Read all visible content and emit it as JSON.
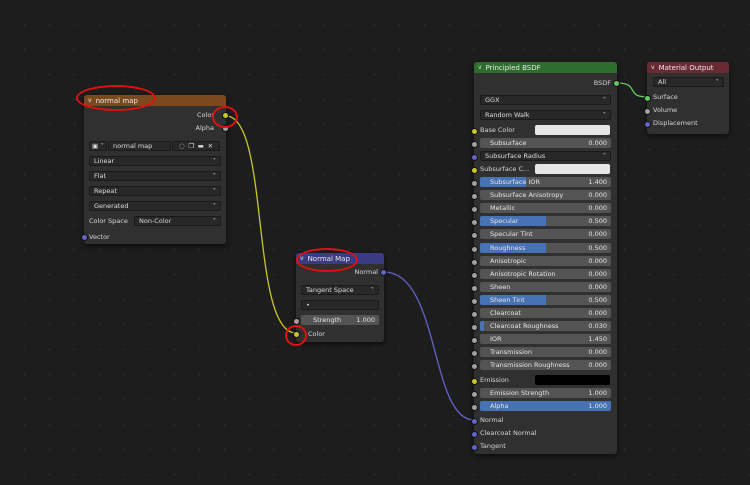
{
  "nodes": {
    "image": {
      "title": "normal map",
      "outputs": [
        "Color",
        "Alpha"
      ],
      "image_name": "normal map",
      "dropdowns": [
        "Linear",
        "Flat",
        "Repeat",
        "Generated"
      ],
      "color_space_label": "Color Space",
      "color_space_value": "Non-Color",
      "input": "Vector",
      "header_color": "#7a4a1e"
    },
    "normal_map": {
      "title": "Normal Map",
      "output": "Normal",
      "space": "Tangent Space",
      "uv_value": "•",
      "strength_label": "Strength",
      "strength_value": "1.000",
      "input": "Color",
      "header_color": "#3b3b84"
    },
    "bsdf": {
      "title": "Principled BSDF",
      "output": "BSDF",
      "distribution": "GGX",
      "subsurface_method": "Random Walk",
      "base_color_label": "Base Color",
      "subsurface": {
        "label": "Subsurface",
        "value": "0.000"
      },
      "subsurface_radius": "Subsurface Radius",
      "subsurface_color_label": "Subsurface C...",
      "fields": [
        {
          "label": "Subsurface IOR",
          "value": "1.400",
          "fill": 0.35
        },
        {
          "label": "Subsurface Anisotropy",
          "value": "0.000",
          "fill": 0
        },
        {
          "label": "Metallic",
          "value": "0.000",
          "fill": 0
        },
        {
          "label": "Specular",
          "value": "0.500",
          "fill": 0.5
        },
        {
          "label": "Specular Tint",
          "value": "0.000",
          "fill": 0
        },
        {
          "label": "Roughness",
          "value": "0.500",
          "fill": 0.5
        },
        {
          "label": "Anisotropic",
          "value": "0.000",
          "fill": 0
        },
        {
          "label": "Anisotropic Rotation",
          "value": "0.000",
          "fill": 0
        },
        {
          "label": "Sheen",
          "value": "0.000",
          "fill": 0
        },
        {
          "label": "Sheen Tint",
          "value": "0.500",
          "fill": 0.5
        },
        {
          "label": "Clearcoat",
          "value": "0.000",
          "fill": 0
        },
        {
          "label": "Clearcoat Roughness",
          "value": "0.030",
          "fill": 0.03
        },
        {
          "label": "IOR",
          "value": "1.450",
          "fill": 0
        },
        {
          "label": "Transmission",
          "value": "0.000",
          "fill": 0
        },
        {
          "label": "Transmission Roughness",
          "value": "0.000",
          "fill": 0
        }
      ],
      "emission_label": "Emission",
      "emission_strength": {
        "label": "Emission Strength",
        "value": "1.000"
      },
      "alpha": {
        "label": "Alpha",
        "value": "1.000",
        "fill": 1
      },
      "inputs_tail": [
        "Normal",
        "Clearcoat Normal",
        "Tangent"
      ],
      "header_color": "#2d6d2d"
    },
    "output": {
      "title": "Material Output",
      "target": "All",
      "inputs": [
        "Surface",
        "Volume",
        "Displacement"
      ],
      "header_color": "#6a2a33"
    }
  }
}
